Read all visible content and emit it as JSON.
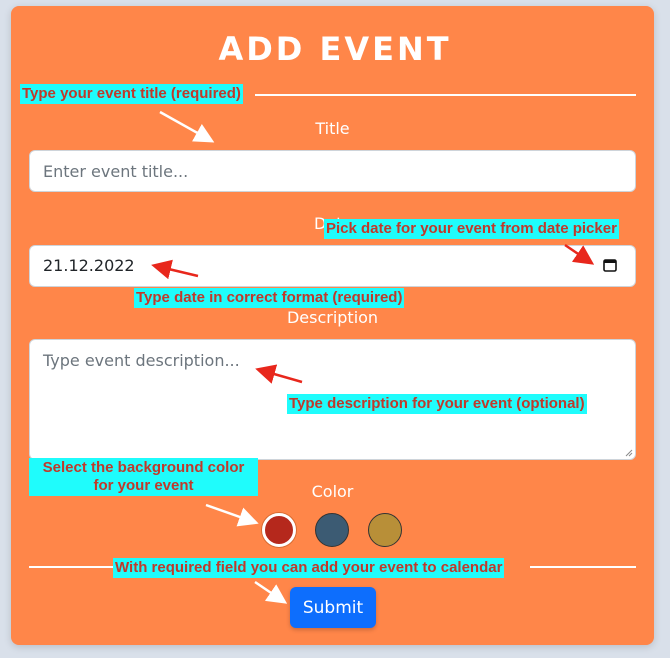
{
  "form": {
    "heading": "ADD EVENT",
    "title_label": "Title",
    "title_placeholder": "Enter event title...",
    "date_label": "Date",
    "date_value": "21.12.2022",
    "description_label": "Description",
    "description_placeholder": "Type event description...",
    "color_label": "Color",
    "colors": [
      {
        "name": "red",
        "hex": "#b5281c",
        "selected": true
      },
      {
        "name": "slate",
        "hex": "#3c5b73",
        "selected": false
      },
      {
        "name": "gold",
        "hex": "#b88f38",
        "selected": false
      }
    ],
    "submit_label": "Submit"
  },
  "hints": {
    "title": "Type your event title (required)",
    "date_picker": "Pick date for your event from date picker",
    "date_format": "Type date in correct format (required)",
    "description": "Type description for your event (optional)",
    "color": "Select the background color for your event",
    "submit": "With required field you can add your event to calendar"
  }
}
